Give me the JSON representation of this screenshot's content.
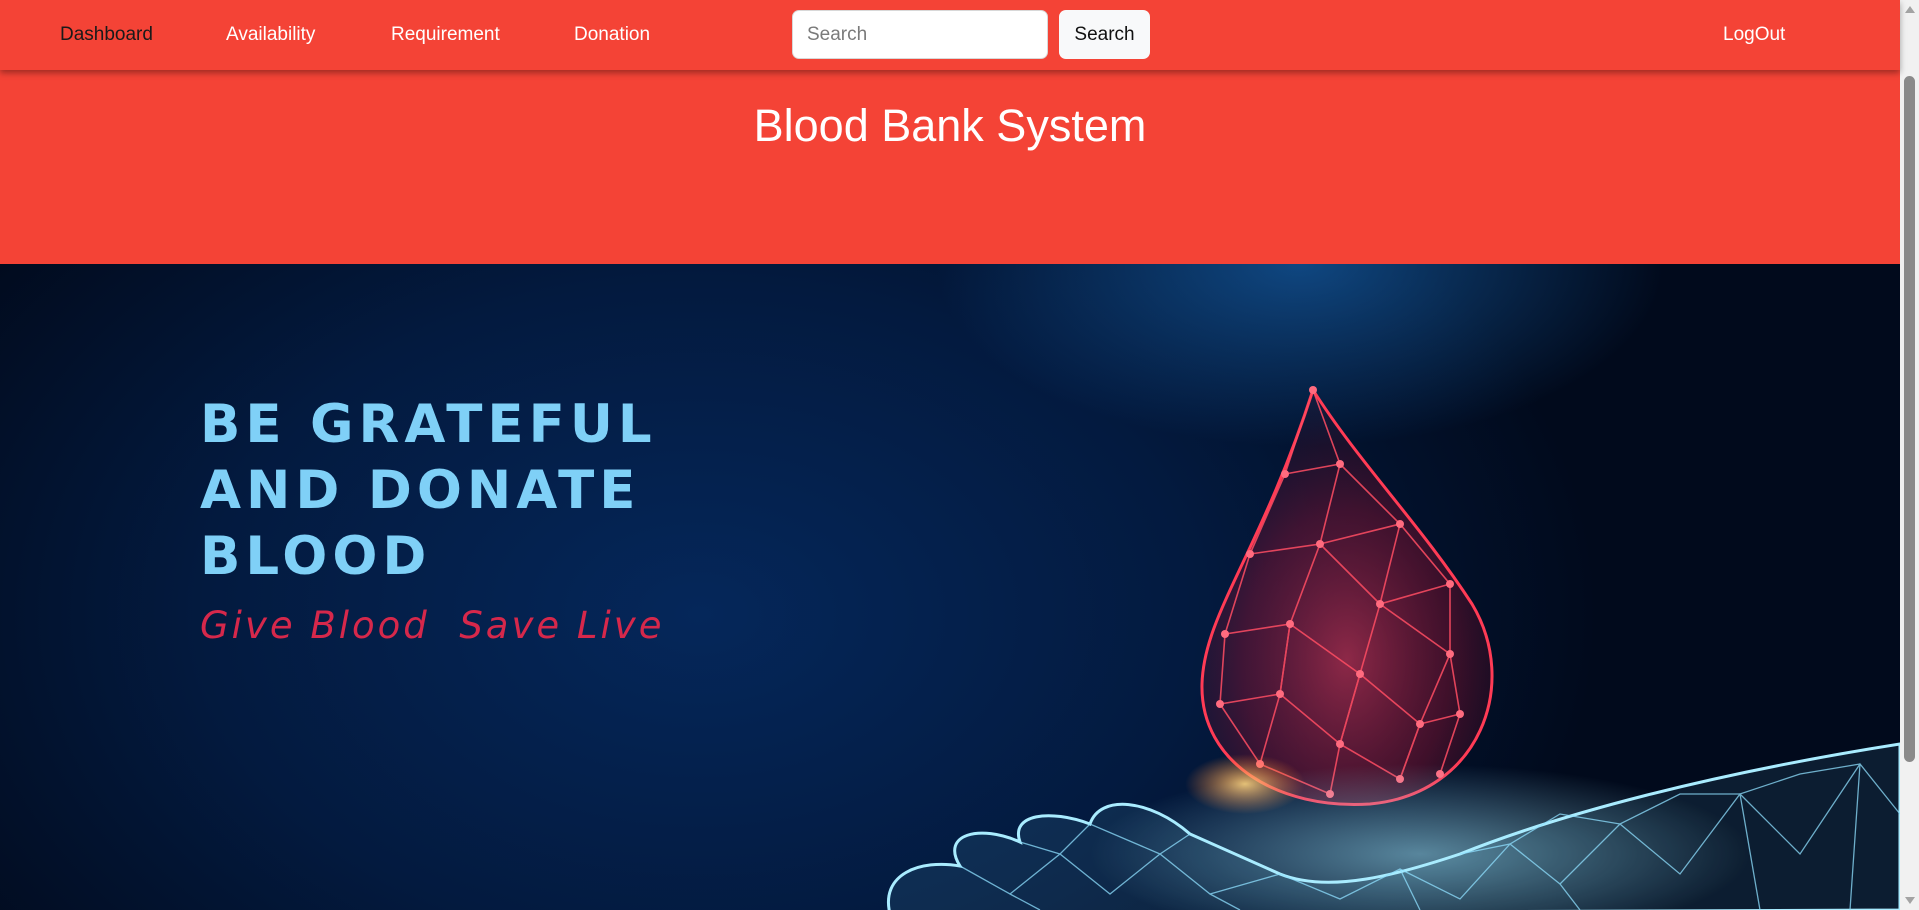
{
  "nav": {
    "links": [
      {
        "label": "Dashboard",
        "active": true
      },
      {
        "label": "Availability",
        "active": false
      },
      {
        "label": "Requirement",
        "active": false
      },
      {
        "label": "Donation",
        "active": false
      }
    ],
    "search_placeholder": "Search",
    "search_button": "Search",
    "logout": "LogOut"
  },
  "header": {
    "title": "Blood Bank System"
  },
  "banner": {
    "heading": "BE GRATEFUL\nAND DONATE\nBLOOD",
    "tagline": "Give Blood  Save Live"
  },
  "colors": {
    "brand": "#f44336",
    "heading": "#7fd0f7",
    "tagline": "#d6284b",
    "banner_bg": "#031a3f"
  }
}
